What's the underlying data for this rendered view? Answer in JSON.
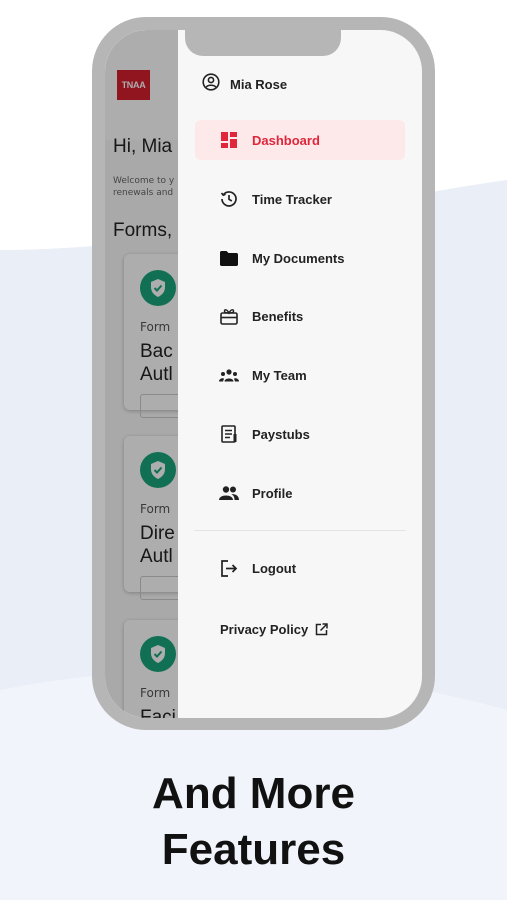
{
  "app": {
    "logo_text": "TNAA",
    "greeting": "Hi, Mia",
    "welcome_line1": "Welcome to y",
    "welcome_line2": "renewals and",
    "forms_title": "Forms,",
    "cards": [
      {
        "label": "Form",
        "name_line1": "Bac",
        "name_line2": "Autl"
      },
      {
        "label": "Form",
        "name_line1": "Dire",
        "name_line2": "Autl"
      },
      {
        "label": "Form",
        "name_line1": "Faci",
        "name_line2": ""
      }
    ]
  },
  "drawer": {
    "user_name": "Mia Rose",
    "items": [
      {
        "label": "Dashboard",
        "icon": "dashboard-icon",
        "active": true
      },
      {
        "label": "Time Tracker",
        "icon": "time-tracker-icon"
      },
      {
        "label": "My Documents",
        "icon": "folder-icon"
      },
      {
        "label": "Benefits",
        "icon": "benefits-icon"
      },
      {
        "label": "My Team",
        "icon": "team-icon"
      },
      {
        "label": "Paystubs",
        "icon": "paystub-icon"
      },
      {
        "label": "Profile",
        "icon": "profile-icon"
      }
    ],
    "logout_label": "Logout",
    "privacy_label": "Privacy Policy"
  },
  "caption": {
    "line1": "And More",
    "line2": "Features"
  },
  "colors": {
    "accent": "#e0263a",
    "active_bg": "#fde8ea",
    "shield_green": "#1aa67c",
    "phone_frame": "#b6b6b6",
    "background_wave": "#e9eef7"
  }
}
